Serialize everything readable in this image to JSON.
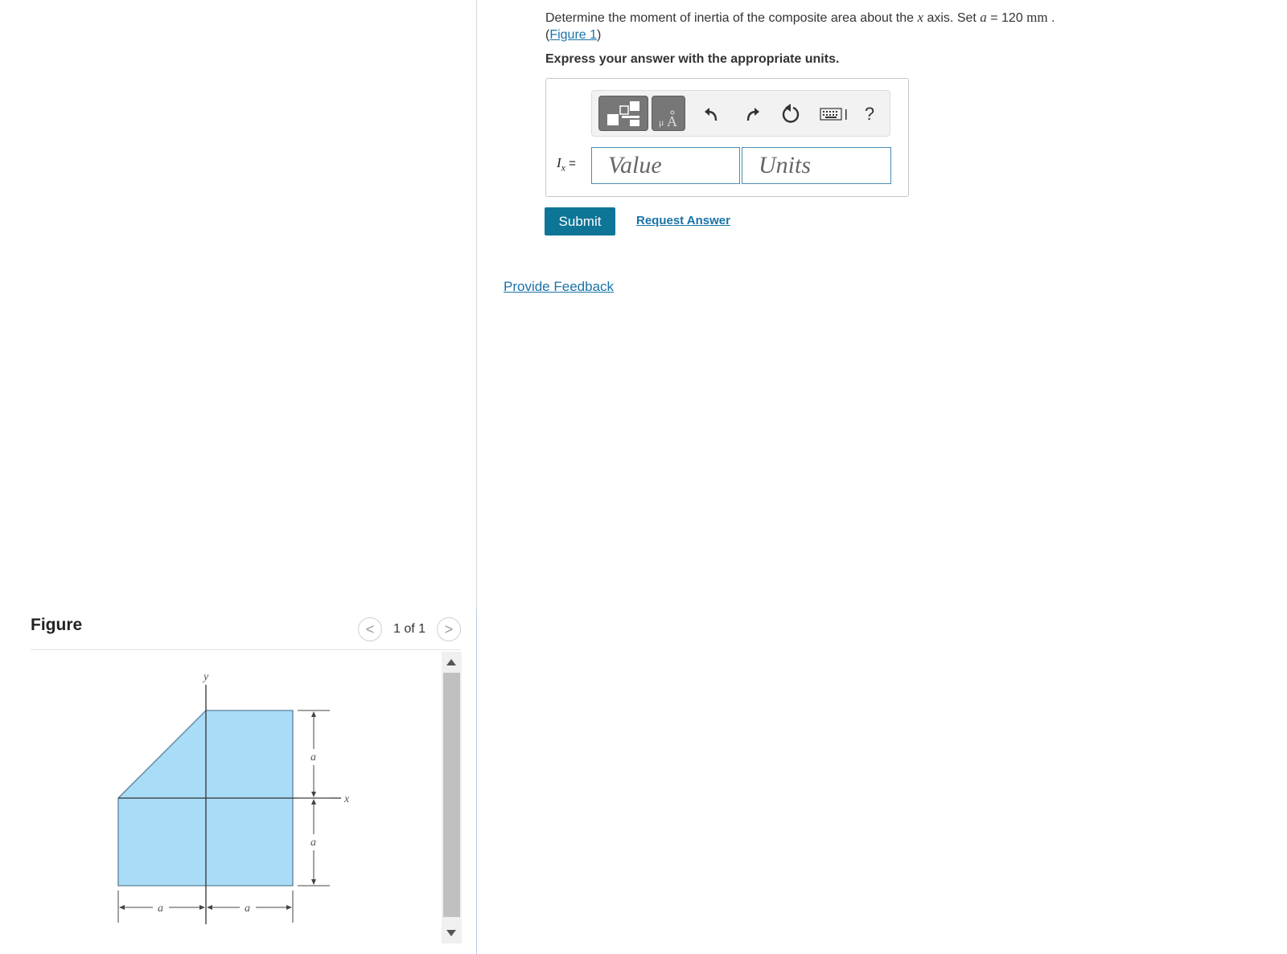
{
  "problem": {
    "text_before_var": "Determine the moment of inertia of the composite area about the ",
    "axis_var": "x",
    "text_mid": " axis. Set ",
    "param_var": "a",
    "equals_value": " = 120 ",
    "unit": "mm",
    "period": " .",
    "figure_ref_open": "(",
    "figure_link": "Figure 1",
    "figure_ref_close": ")",
    "express": "Express your answer with the appropriate units."
  },
  "answer": {
    "var_main": "I",
    "var_sub": "x",
    "equals": " =",
    "value_placeholder": "Value",
    "units_placeholder": "Units",
    "help_label": "?"
  },
  "toolbar_icons": [
    "templates-icon",
    "units-symbol-icon",
    "undo-icon",
    "redo-icon",
    "reset-icon",
    "keyboard-icon",
    "help-icon"
  ],
  "actions": {
    "submit": "Submit",
    "request_answer": "Request Answer",
    "provide_feedback": "Provide Feedback"
  },
  "figure": {
    "title": "Figure",
    "pager": "1 of 1",
    "prev": "<",
    "next": ">",
    "labels": {
      "y_axis": "y",
      "x_axis": "x",
      "dim_a_top": "a",
      "dim_a_bottom": "a",
      "dim_a_left": "a",
      "dim_a_right": "a"
    },
    "colors": {
      "fill": "#a9dcf7",
      "outline": "#5b7f99"
    }
  }
}
